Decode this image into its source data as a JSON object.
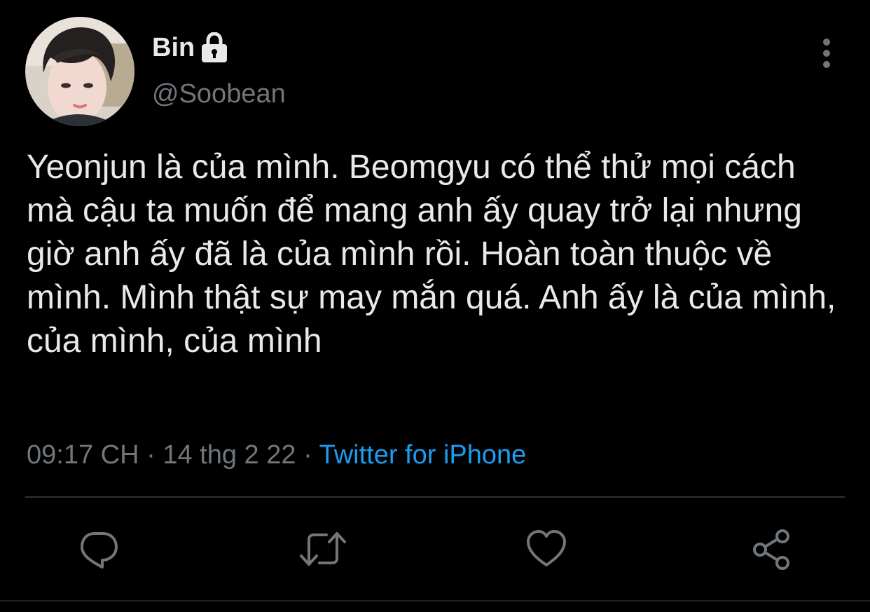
{
  "tweet": {
    "author": {
      "display_name": "Bin",
      "handle": "@Soobean",
      "avatar_icon": "profile-photo",
      "protected_icon": "lock-icon"
    },
    "text": "Yeonjun là của mình. Beomgyu có thể thử mọi cách mà cậu ta muốn để mang anh ấy quay trở lại nhưng giờ anh ấy đã là của mình rồi. Hoàn toàn thuộc về mình. Mình thật sự may mắn quá. Anh ấy là của mình, của mình, của mình",
    "time": "09:17 CH",
    "separator": "·",
    "date": "14 thg 2 22",
    "source": "Twitter for iPhone",
    "more_icon": "more-vertical-icon"
  },
  "actions": [
    {
      "name": "reply",
      "icon": "comment-icon"
    },
    {
      "name": "retweet",
      "icon": "retweet-icon"
    },
    {
      "name": "like",
      "icon": "heart-icon"
    },
    {
      "name": "share",
      "icon": "share-icon"
    }
  ],
  "colors": {
    "background": "#000000",
    "text_primary": "#e7e9ea",
    "text_secondary": "#71767b",
    "accent": "#1d9bf0",
    "divider": "#2f3336"
  }
}
